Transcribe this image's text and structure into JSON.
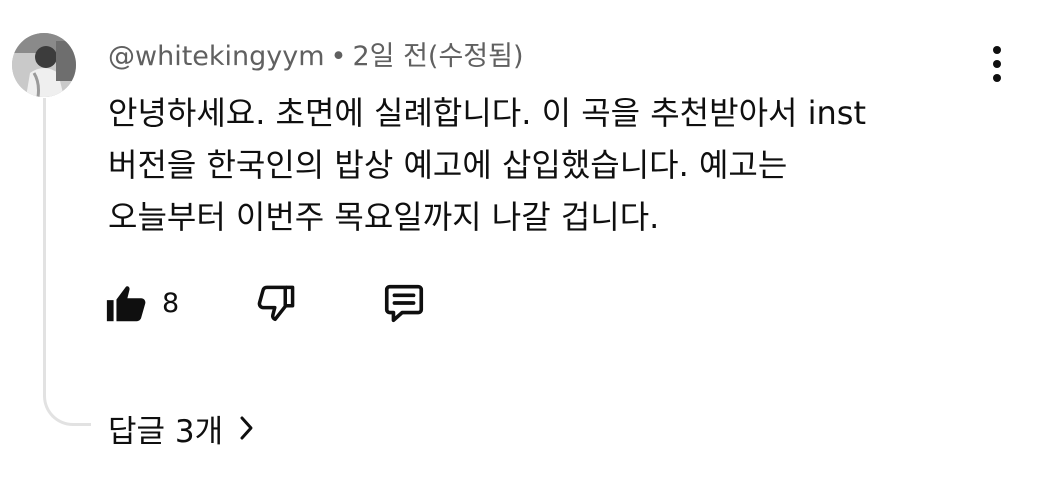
{
  "comment": {
    "author": "@whitekingyym",
    "separator": "•",
    "time": "2일 전(수정됨)",
    "lines": [
      "안녕하세요. 초면에 실례합니다. 이 곡을 추천받아서 inst",
      "버전을 한국인의 밥상 예고에 삽입했습니다. 예고는",
      "오늘부터 이번주 목요일까지 나갈 겁니다."
    ],
    "likes": "8",
    "replies_label": "답글 3개"
  },
  "icons": {
    "avatar": "user-avatar-photo",
    "more": "more-vert-icon",
    "like": "thumbs-up-filled-icon",
    "dislike": "thumbs-down-outline-icon",
    "reply": "comment-reply-icon",
    "chevron": "chevron-right-icon"
  },
  "colors": {
    "text": "#0f0f0f",
    "meta": "#606060",
    "thread_line": "#e2e2e2"
  }
}
